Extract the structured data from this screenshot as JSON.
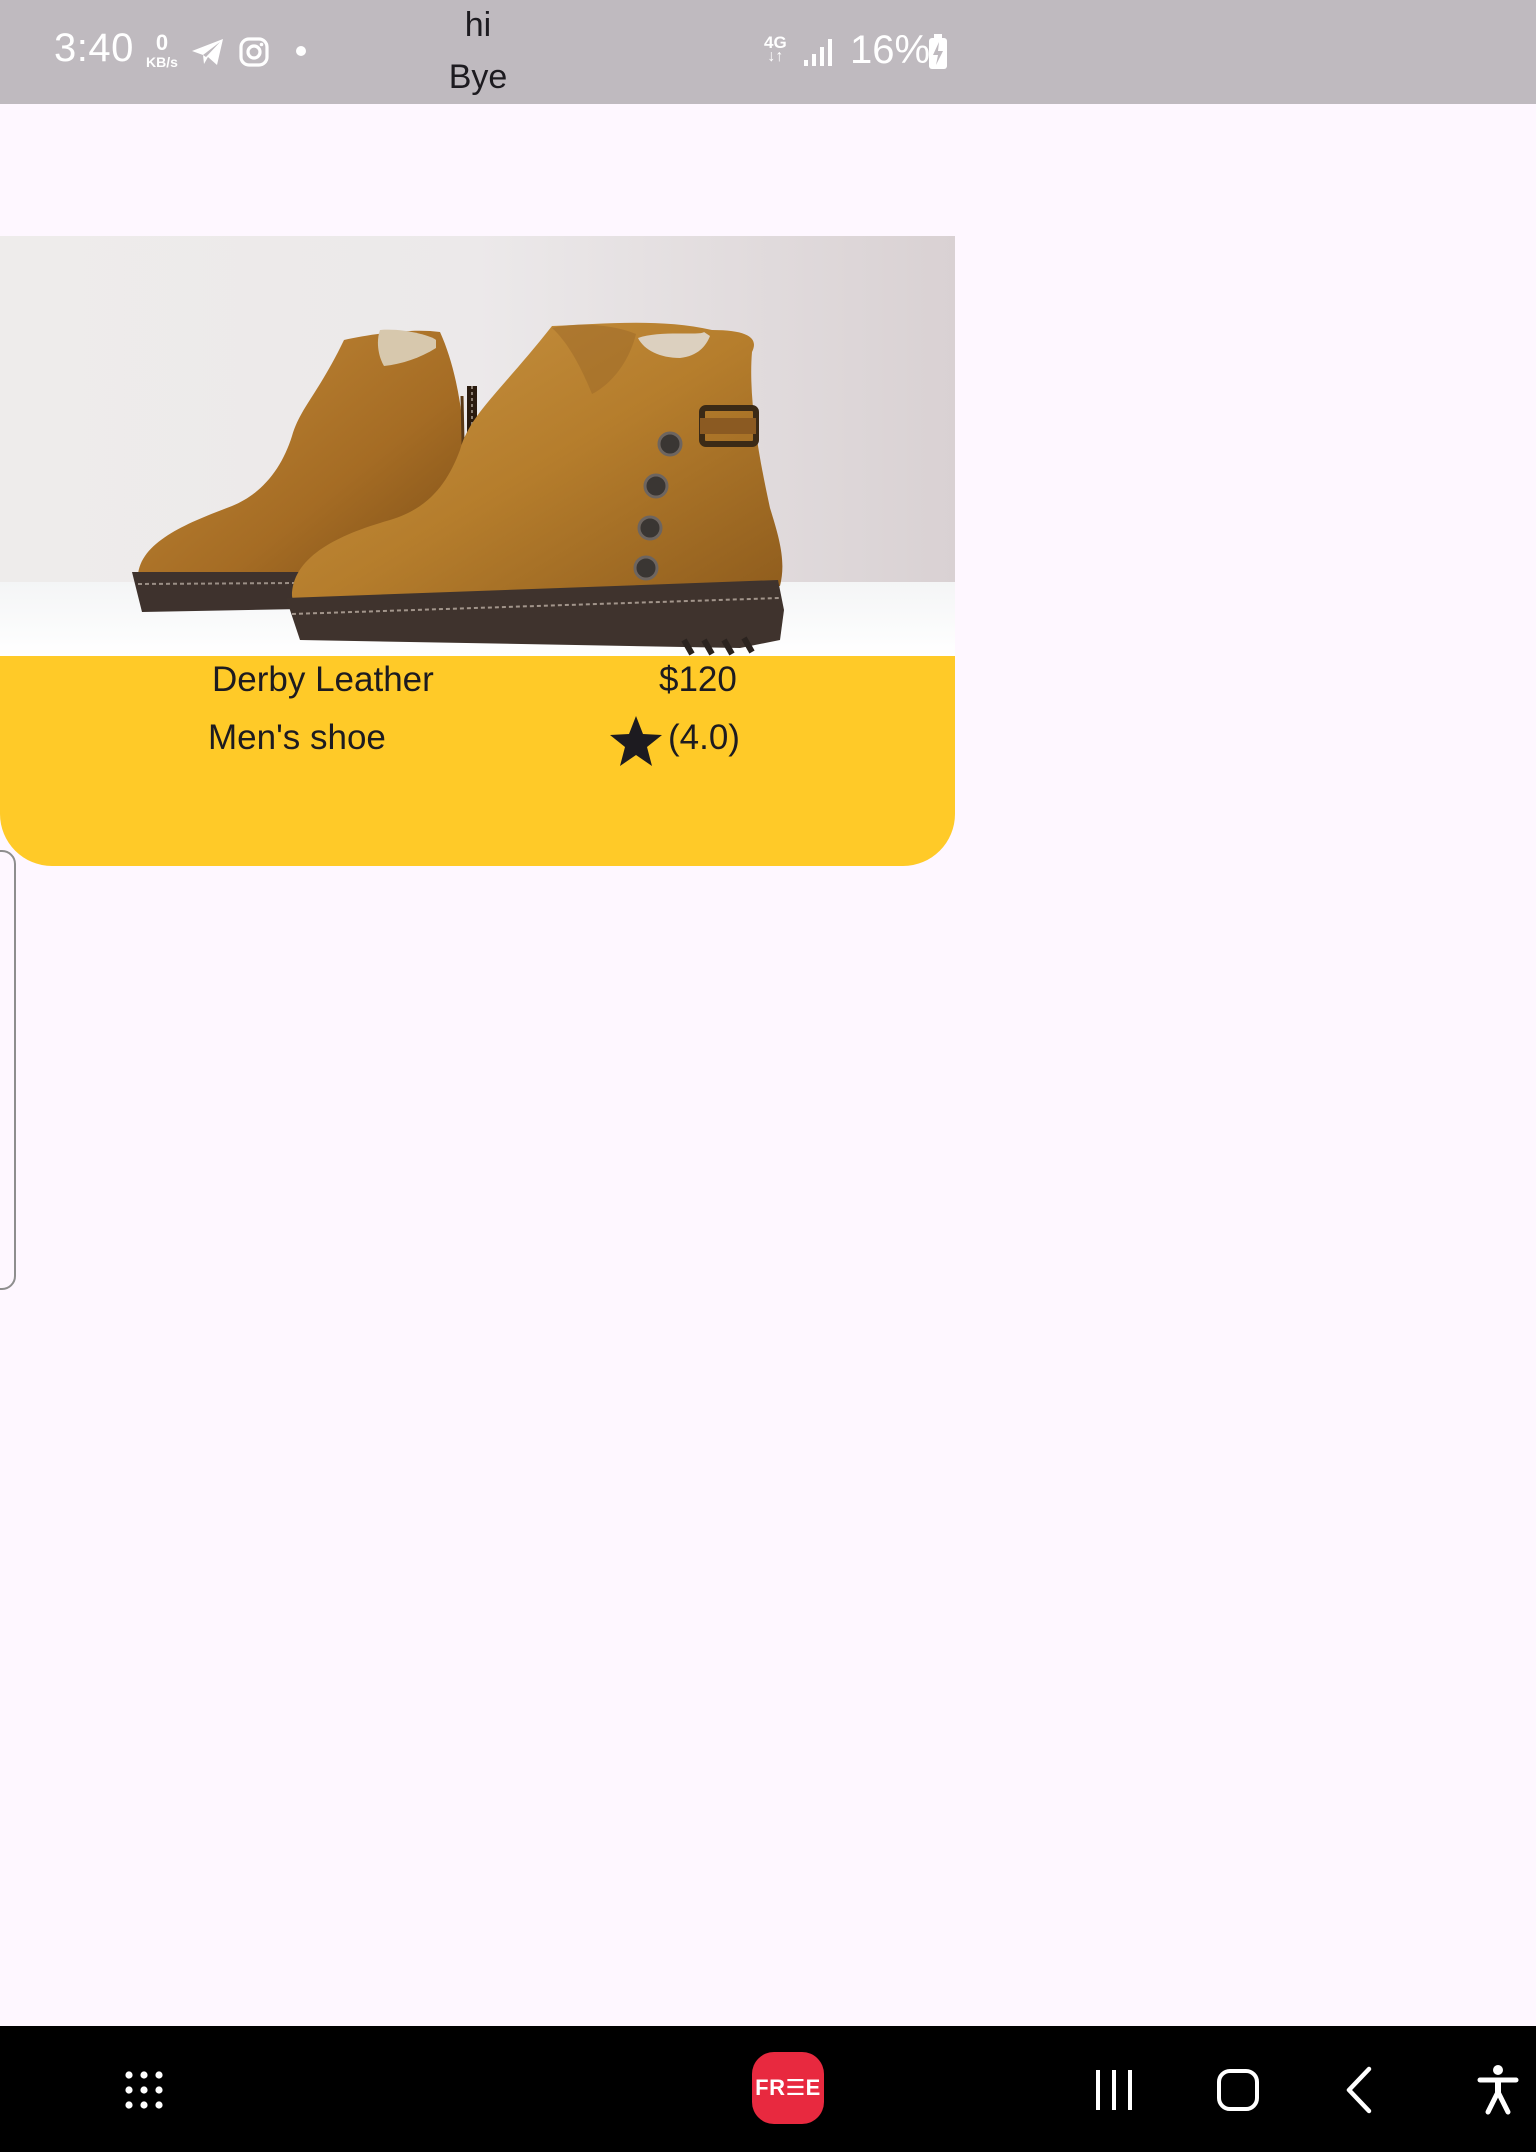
{
  "status_bar": {
    "time": "3:40",
    "data_speed_value": "0",
    "data_speed_unit": "KB/s",
    "network_type": "4G",
    "network_arrows": "↓↑",
    "battery_percent": "16%"
  },
  "overlay": {
    "line1": "hi",
    "line2": "Bye"
  },
  "product": {
    "name": "Derby Leather",
    "price": "$120",
    "category": "Men's shoe",
    "rating": "(4.0)",
    "rating_value": 4.0
  },
  "nav_bar": {
    "app_badge": "FR☰E"
  },
  "colors": {
    "card_accent": "#ffca28",
    "status_bar": "#bfbabf",
    "background": "#fef7ff",
    "badge": "#e8293f"
  },
  "icons": {
    "telegram": "telegram-icon",
    "instagram": "instagram-icon",
    "signal": "signal-icon",
    "battery": "battery-charging-icon",
    "star": "star-icon",
    "apps": "apps-grid-icon",
    "recents": "recents-icon",
    "home": "home-icon",
    "back": "back-icon",
    "accessibility": "accessibility-icon"
  }
}
